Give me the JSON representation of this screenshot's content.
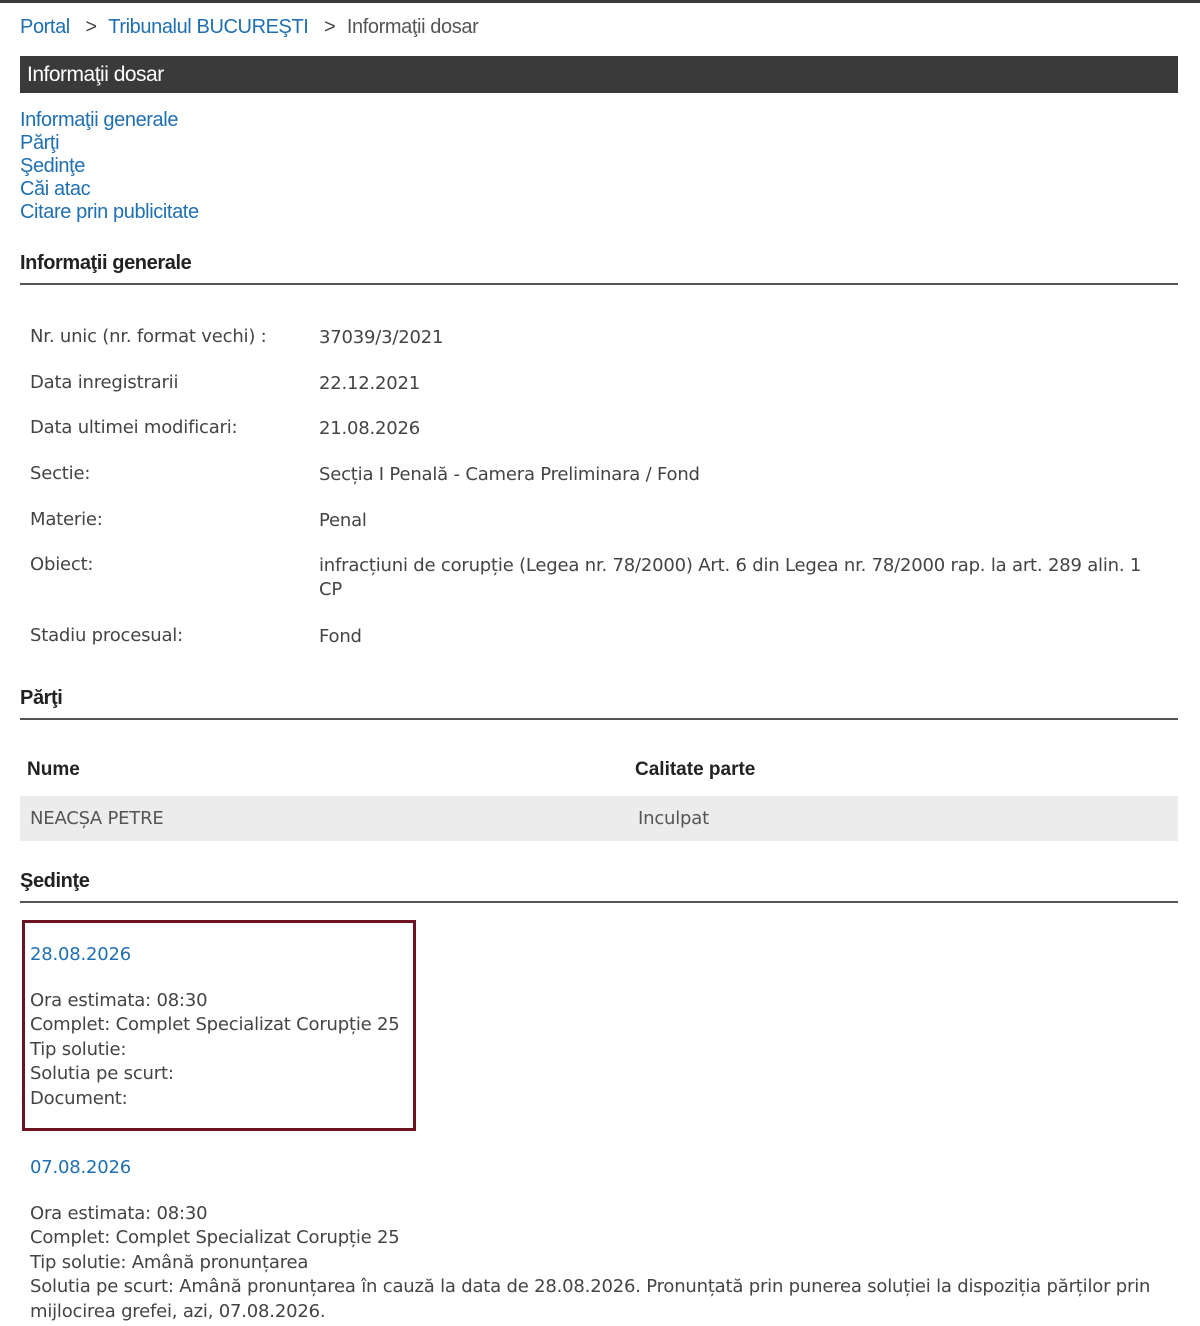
{
  "breadcrumb": {
    "items": [
      "Portal",
      "Tribunalul BUCUREŞTI"
    ],
    "separator": ">",
    "current": "Informaţii dosar"
  },
  "title_bar": "Informaţii dosar",
  "nav_links": [
    "Informaţii generale",
    "Părţi",
    "Şedinţe",
    "Căi atac",
    "Citare prin publicitate"
  ],
  "general": {
    "heading": "Informaţii generale",
    "rows": [
      {
        "label": "Nr. unic (nr. format vechi) :",
        "value": "37039/3/2021"
      },
      {
        "label": "Data inregistrarii",
        "value": "22.12.2021"
      },
      {
        "label": "Data ultimei modificari:",
        "value": "21.08.2026"
      },
      {
        "label": "Sectie:",
        "value": "Secția I Penală - Camera Preliminara / Fond"
      },
      {
        "label": "Materie:",
        "value": "Penal"
      },
      {
        "label": "Obiect:",
        "value": "infracțiuni de corupție (Legea nr. 78/2000) Art. 6 din Legea nr. 78/2000 rap. la art. 289 alin. 1 CP"
      },
      {
        "label": "Stadiu procesual:",
        "value": "Fond"
      }
    ]
  },
  "parti": {
    "heading": "Părţi",
    "columns": [
      "Nume",
      "Calitate parte"
    ],
    "rows": [
      {
        "nume": "NEACȘA PETRE",
        "calitate": "Inculpat"
      }
    ]
  },
  "sedinte": {
    "heading": "Şedinţe",
    "items": [
      {
        "date": "28.08.2026",
        "ora": "Ora estimata: 08:30",
        "complet": "Complet: Complet Specializat Corupție 25",
        "tip": "Tip solutie:",
        "solutie": "Solutia pe scurt:",
        "document": "Document:"
      },
      {
        "date": "07.08.2026",
        "ora": "Ora estimata: 08:30",
        "complet": "Complet: Complet Specializat Corupție 25",
        "tip": "Tip solutie: Amână pronunțarea",
        "solutie": "Solutia pe scurt: Amână pronunțarea în cauză la data de 28.08.2026. Pronunțată prin punerea soluției la dispoziția părților prin mijlocirea grefei, azi, 07.08.2026."
      }
    ]
  },
  "colors": {
    "link": "#1f6fb2",
    "title_bar_bg": "#3a3a3a",
    "highlight_border": "#6d1424",
    "row_bg": "#ececec"
  }
}
